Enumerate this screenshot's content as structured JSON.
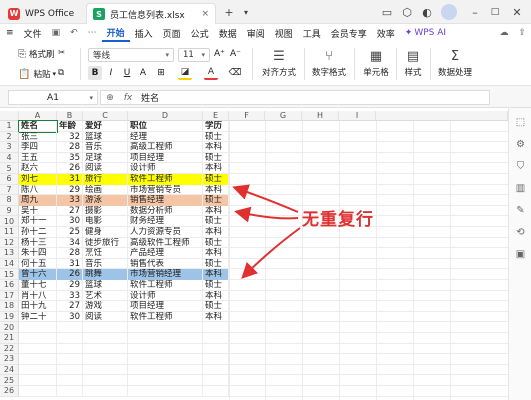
{
  "titlebar": {
    "app_tab": "WPS Office",
    "doc_tab": "员工信息列表.xlsx",
    "new_tab": "+",
    "close": "×"
  },
  "menu": {
    "items": [
      "文件",
      "开始",
      "插入",
      "页面",
      "公式",
      "数据",
      "审阅",
      "视图",
      "工具",
      "会员专享",
      "效率",
      "WPS AI"
    ],
    "active": "开始"
  },
  "ribbon": {
    "format_painter": "格式刷",
    "paste": "粘贴",
    "font_name": "等线",
    "font_size": "11",
    "bold": "B",
    "italic": "I",
    "underline": "U",
    "align_label": "对齐方式",
    "number_format_label": "数字格式",
    "cells_label": "单元格",
    "styles_label": "样式",
    "data_processing_label": "数据处理"
  },
  "formula_bar": {
    "cell_ref": "A1",
    "fx": "fx",
    "content": "姓名"
  },
  "columns": [
    "A",
    "B",
    "C",
    "D",
    "E",
    "F",
    "G",
    "H",
    "I"
  ],
  "rows": [
    {
      "n": "1",
      "cells": [
        "姓名",
        "年龄",
        "爱好",
        "职位",
        "学历"
      ],
      "bold": true
    },
    {
      "n": "2",
      "cells": [
        "张三",
        "32",
        "篮球",
        "经理",
        "硕士"
      ]
    },
    {
      "n": "3",
      "cells": [
        "李四",
        "28",
        "音乐",
        "高级工程师",
        "本科"
      ]
    },
    {
      "n": "4",
      "cells": [
        "王五",
        "35",
        "足球",
        "项目经理",
        "硕士"
      ]
    },
    {
      "n": "5",
      "cells": [
        "赵六",
        "26",
        "阅读",
        "设计师",
        "本科"
      ]
    },
    {
      "n": "6",
      "cells": [
        "刘七",
        "31",
        "旅行",
        "软件工程师",
        "硕士"
      ],
      "highlight": "#ffff00"
    },
    {
      "n": "7",
      "cells": [
        "陈八",
        "29",
        "绘画",
        "市场营销专员",
        "本科"
      ]
    },
    {
      "n": "8",
      "cells": [
        "周九",
        "33",
        "游泳",
        "销售经理",
        "硕士"
      ],
      "highlight": "#f5c6a5"
    },
    {
      "n": "9",
      "cells": [
        "吴十",
        "27",
        "摄影",
        "数据分析师",
        "本科"
      ]
    },
    {
      "n": "10",
      "cells": [
        "郑十一",
        "30",
        "电影",
        "财务经理",
        "硕士"
      ]
    },
    {
      "n": "11",
      "cells": [
        "孙十二",
        "25",
        "健身",
        "人力资源专员",
        "本科"
      ]
    },
    {
      "n": "12",
      "cells": [
        "杨十三",
        "34",
        "徒步旅行",
        "高级软件工程师",
        "硕士"
      ]
    },
    {
      "n": "13",
      "cells": [
        "朱十四",
        "28",
        "烹饪",
        "产品经理",
        "本科"
      ]
    },
    {
      "n": "14",
      "cells": [
        "何十五",
        "31",
        "音乐",
        "销售代表",
        "硕士"
      ]
    },
    {
      "n": "15",
      "cells": [
        "曾十六",
        "26",
        "跳舞",
        "市场营销经理",
        "本科"
      ],
      "highlight": "#9dc3e6"
    },
    {
      "n": "16",
      "cells": [
        "董十七",
        "29",
        "篮球",
        "软件工程师",
        "硕士"
      ]
    },
    {
      "n": "17",
      "cells": [
        "肖十八",
        "33",
        "艺术",
        "设计师",
        "本科"
      ]
    },
    {
      "n": "18",
      "cells": [
        "田十九",
        "27",
        "游戏",
        "项目经理",
        "硕士"
      ]
    },
    {
      "n": "19",
      "cells": [
        "钟二十",
        "30",
        "阅读",
        "软件工程师",
        "本科"
      ]
    },
    {
      "n": "20",
      "cells": [
        "",
        "",
        "",
        "",
        ""
      ]
    },
    {
      "n": "21",
      "cells": [
        "",
        "",
        "",
        "",
        ""
      ]
    },
    {
      "n": "22",
      "cells": [
        "",
        "",
        "",
        "",
        ""
      ]
    },
    {
      "n": "23",
      "cells": [
        "",
        "",
        "",
        "",
        ""
      ]
    },
    {
      "n": "24",
      "cells": [
        "",
        "",
        "",
        "",
        ""
      ]
    },
    {
      "n": "25",
      "cells": [
        "",
        "",
        "",
        "",
        ""
      ]
    },
    {
      "n": "26",
      "cells": [
        "",
        "",
        "",
        "",
        ""
      ]
    }
  ],
  "annotation": {
    "text": "无重复行",
    "color": "#e03030"
  },
  "colors": {
    "accent": "#1a5fd0",
    "excel_green": "#1aa260",
    "wps_red": "#e53935"
  }
}
